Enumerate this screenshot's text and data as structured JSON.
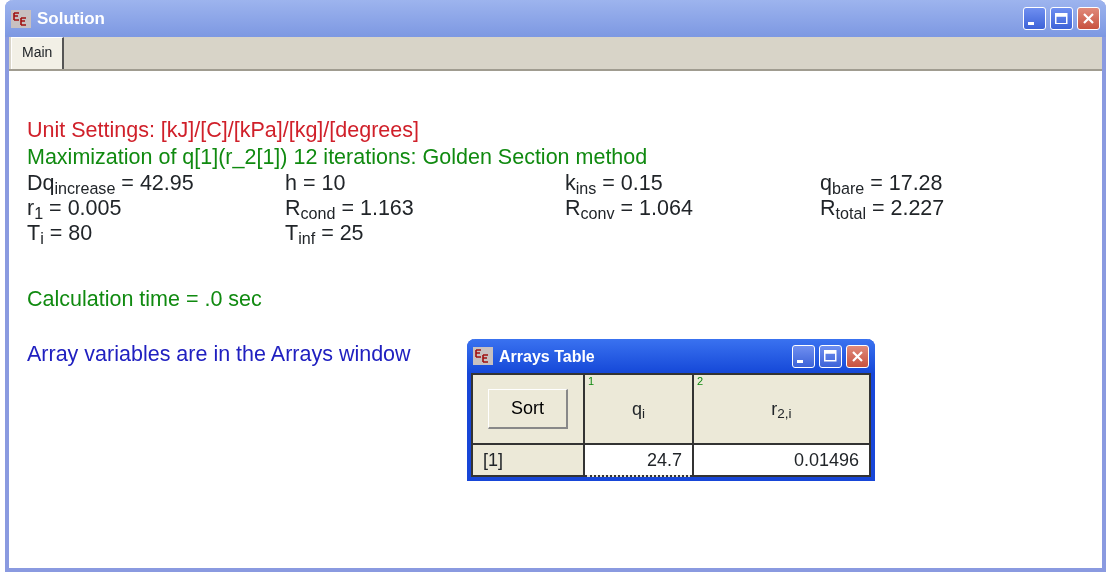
{
  "window": {
    "title": "Solution",
    "tabs": [
      {
        "label": "Main",
        "selected": true
      }
    ]
  },
  "unit_settings": "Unit Settings: [kJ]/[C]/[kPa]/[kg]/[degrees]",
  "status": "Maximization of q[1](r_2[1])  12 iterations:  Golden Section method",
  "variables": [
    [
      "Dq$_{increase}$  = 42.95",
      "h = 10",
      "k$_{ins}$ = 0.15",
      "q$_{bare}$ = 17.28"
    ],
    [
      "r$_{1}$  = 0.005",
      "R$_{cond}$ = 1.163",
      "R$_{conv}$ = 1.064",
      "R$_{total}$  = 2.227"
    ],
    [
      "T$_{i}$ = 80",
      "T$_{inf}$ = 25"
    ]
  ],
  "calculation_time": "Calculation time = .0 sec",
  "array_note": "Array variables are in the Arrays window",
  "arrays_window": {
    "title": "Arrays Table",
    "sort_button": "Sort",
    "columns": [
      {
        "number": "1",
        "label": "q$_{i}$"
      },
      {
        "number": "2",
        "label": "r$_{2,i}$"
      }
    ],
    "rows": [
      {
        "index": "[1]",
        "cells": [
          {
            "value": "24.7",
            "selected": true
          },
          {
            "value": "0.01496",
            "selected": false
          }
        ]
      }
    ]
  }
}
